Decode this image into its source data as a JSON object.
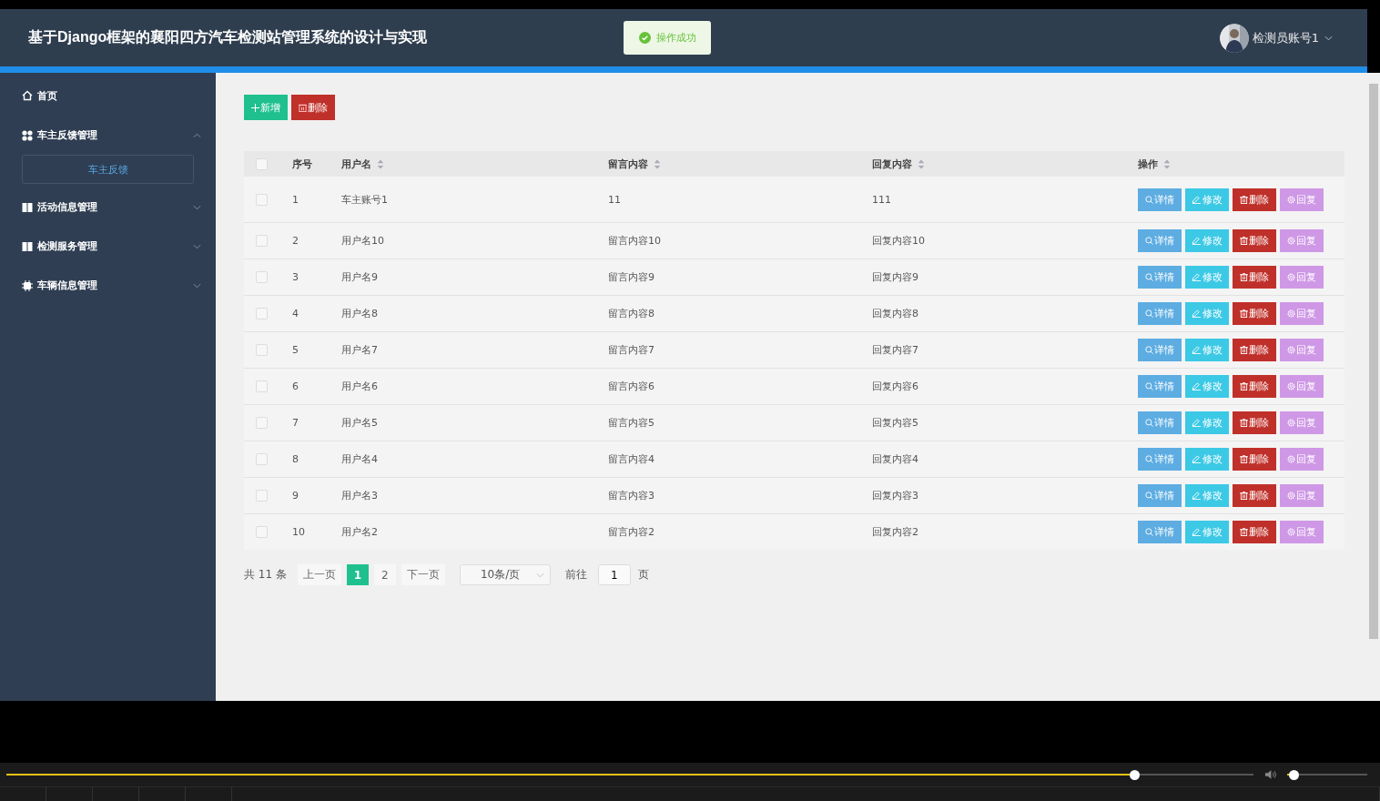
{
  "header": {
    "title": "基于Django框架的襄阳四方汽车检测站管理系统的设计与实现",
    "toast": "操作成功",
    "user": "检测员账号1"
  },
  "sidebar": {
    "items": [
      {
        "label": "首页",
        "kind": "home"
      },
      {
        "label": "车主反馈管理",
        "kind": "grid",
        "expanded": true,
        "children": [
          {
            "label": "车主反馈",
            "selected": true
          }
        ]
      },
      {
        "label": "活动信息管理",
        "kind": "table",
        "expanded": false
      },
      {
        "label": "检测服务管理",
        "kind": "table",
        "expanded": false
      },
      {
        "label": "车辆信息管理",
        "kind": "chip",
        "expanded": false
      }
    ]
  },
  "toolbar": [
    {
      "label": "新增",
      "kind": "add"
    },
    {
      "label": "删除",
      "kind": "delete"
    }
  ],
  "table": {
    "select_all": {
      "checked": false
    },
    "columns": [
      {
        "label": "序号",
        "sortable": false
      },
      {
        "label": "用户名",
        "sortable": true
      },
      {
        "label": "留言内容",
        "sortable": true
      },
      {
        "label": "回复内容",
        "sortable": true
      },
      {
        "label": "操作",
        "sortable": true
      }
    ],
    "rows": [
      {
        "checked": false,
        "cells": [
          "1",
          "车主账号1",
          "11",
          "111"
        ],
        "actions": [
          {
            "label": "详情",
            "kind": "detail"
          },
          {
            "label": "修改",
            "kind": "edit"
          },
          {
            "label": "删除",
            "kind": "delete"
          },
          {
            "label": "回复",
            "kind": "reply"
          }
        ]
      },
      {
        "checked": false,
        "cells": [
          "2",
          "用户名10",
          "留言内容10",
          "回复内容10"
        ],
        "actions": [
          {
            "label": "详情",
            "kind": "detail"
          },
          {
            "label": "修改",
            "kind": "edit"
          },
          {
            "label": "删除",
            "kind": "delete"
          },
          {
            "label": "回复",
            "kind": "reply"
          }
        ]
      },
      {
        "checked": false,
        "cells": [
          "3",
          "用户名9",
          "留言内容9",
          "回复内容9"
        ],
        "actions": [
          {
            "label": "详情",
            "kind": "detail"
          },
          {
            "label": "修改",
            "kind": "edit"
          },
          {
            "label": "删除",
            "kind": "delete"
          },
          {
            "label": "回复",
            "kind": "reply"
          }
        ]
      },
      {
        "checked": false,
        "cells": [
          "4",
          "用户名8",
          "留言内容8",
          "回复内容8"
        ],
        "actions": [
          {
            "label": "详情",
            "kind": "detail"
          },
          {
            "label": "修改",
            "kind": "edit"
          },
          {
            "label": "删除",
            "kind": "delete"
          },
          {
            "label": "回复",
            "kind": "reply"
          }
        ]
      },
      {
        "checked": false,
        "cells": [
          "5",
          "用户名7",
          "留言内容7",
          "回复内容7"
        ],
        "actions": [
          {
            "label": "详情",
            "kind": "detail"
          },
          {
            "label": "修改",
            "kind": "edit"
          },
          {
            "label": "删除",
            "kind": "delete"
          },
          {
            "label": "回复",
            "kind": "reply"
          }
        ]
      },
      {
        "checked": false,
        "cells": [
          "6",
          "用户名6",
          "留言内容6",
          "回复内容6"
        ],
        "actions": [
          {
            "label": "详情",
            "kind": "detail"
          },
          {
            "label": "修改",
            "kind": "edit"
          },
          {
            "label": "删除",
            "kind": "delete"
          },
          {
            "label": "回复",
            "kind": "reply"
          }
        ]
      },
      {
        "checked": false,
        "cells": [
          "7",
          "用户名5",
          "留言内容5",
          "回复内容5"
        ],
        "actions": [
          {
            "label": "详情",
            "kind": "detail"
          },
          {
            "label": "修改",
            "kind": "edit"
          },
          {
            "label": "删除",
            "kind": "delete"
          },
          {
            "label": "回复",
            "kind": "reply"
          }
        ]
      },
      {
        "checked": false,
        "cells": [
          "8",
          "用户名4",
          "留言内容4",
          "回复内容4"
        ],
        "actions": [
          {
            "label": "详情",
            "kind": "detail"
          },
          {
            "label": "修改",
            "kind": "edit"
          },
          {
            "label": "删除",
            "kind": "delete"
          },
          {
            "label": "回复",
            "kind": "reply"
          }
        ]
      },
      {
        "checked": false,
        "cells": [
          "9",
          "用户名3",
          "留言内容3",
          "回复内容3"
        ],
        "actions": [
          {
            "label": "详情",
            "kind": "detail"
          },
          {
            "label": "修改",
            "kind": "edit"
          },
          {
            "label": "删除",
            "kind": "delete"
          },
          {
            "label": "回复",
            "kind": "reply"
          }
        ]
      },
      {
        "checked": false,
        "cells": [
          "10",
          "用户名2",
          "留言内容2",
          "回复内容2"
        ],
        "actions": [
          {
            "label": "详情",
            "kind": "detail"
          },
          {
            "label": "修改",
            "kind": "edit"
          },
          {
            "label": "删除",
            "kind": "delete"
          },
          {
            "label": "回复",
            "kind": "reply"
          }
        ]
      }
    ]
  },
  "pagination": {
    "total": "共 11 条",
    "prev": "上一页",
    "pages": [
      {
        "label": "1",
        "selected": true
      },
      {
        "label": "2",
        "selected": false
      }
    ],
    "next": "下一页",
    "page_size": "10条/页",
    "goto_label": "前往",
    "goto_value": "1",
    "goto_suffix": "页"
  },
  "player": {
    "seek": {
      "level": 0.905
    },
    "volume": {
      "level": 0.08
    }
  }
}
